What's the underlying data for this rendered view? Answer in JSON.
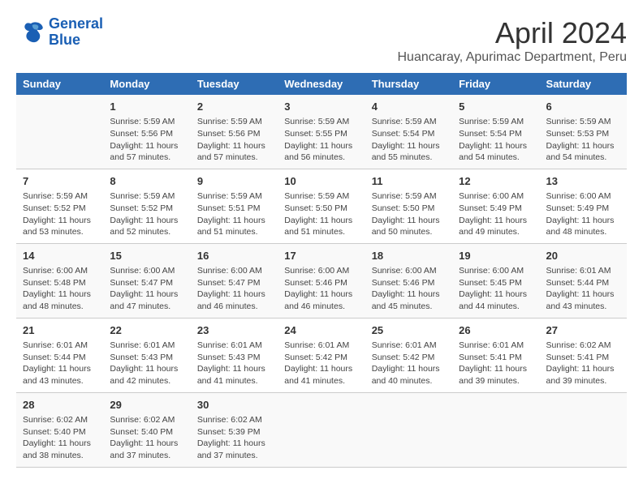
{
  "header": {
    "logo_line1": "General",
    "logo_line2": "Blue",
    "month": "April 2024",
    "location": "Huancaray, Apurimac Department, Peru"
  },
  "columns": [
    "Sunday",
    "Monday",
    "Tuesday",
    "Wednesday",
    "Thursday",
    "Friday",
    "Saturday"
  ],
  "weeks": [
    [
      {
        "day": "",
        "text": ""
      },
      {
        "day": "1",
        "text": "Sunrise: 5:59 AM\nSunset: 5:56 PM\nDaylight: 11 hours\nand 57 minutes."
      },
      {
        "day": "2",
        "text": "Sunrise: 5:59 AM\nSunset: 5:56 PM\nDaylight: 11 hours\nand 57 minutes."
      },
      {
        "day": "3",
        "text": "Sunrise: 5:59 AM\nSunset: 5:55 PM\nDaylight: 11 hours\nand 56 minutes."
      },
      {
        "day": "4",
        "text": "Sunrise: 5:59 AM\nSunset: 5:54 PM\nDaylight: 11 hours\nand 55 minutes."
      },
      {
        "day": "5",
        "text": "Sunrise: 5:59 AM\nSunset: 5:54 PM\nDaylight: 11 hours\nand 54 minutes."
      },
      {
        "day": "6",
        "text": "Sunrise: 5:59 AM\nSunset: 5:53 PM\nDaylight: 11 hours\nand 54 minutes."
      }
    ],
    [
      {
        "day": "7",
        "text": "Sunrise: 5:59 AM\nSunset: 5:52 PM\nDaylight: 11 hours\nand 53 minutes."
      },
      {
        "day": "8",
        "text": "Sunrise: 5:59 AM\nSunset: 5:52 PM\nDaylight: 11 hours\nand 52 minutes."
      },
      {
        "day": "9",
        "text": "Sunrise: 5:59 AM\nSunset: 5:51 PM\nDaylight: 11 hours\nand 51 minutes."
      },
      {
        "day": "10",
        "text": "Sunrise: 5:59 AM\nSunset: 5:50 PM\nDaylight: 11 hours\nand 51 minutes."
      },
      {
        "day": "11",
        "text": "Sunrise: 5:59 AM\nSunset: 5:50 PM\nDaylight: 11 hours\nand 50 minutes."
      },
      {
        "day": "12",
        "text": "Sunrise: 6:00 AM\nSunset: 5:49 PM\nDaylight: 11 hours\nand 49 minutes."
      },
      {
        "day": "13",
        "text": "Sunrise: 6:00 AM\nSunset: 5:49 PM\nDaylight: 11 hours\nand 48 minutes."
      }
    ],
    [
      {
        "day": "14",
        "text": "Sunrise: 6:00 AM\nSunset: 5:48 PM\nDaylight: 11 hours\nand 48 minutes."
      },
      {
        "day": "15",
        "text": "Sunrise: 6:00 AM\nSunset: 5:47 PM\nDaylight: 11 hours\nand 47 minutes."
      },
      {
        "day": "16",
        "text": "Sunrise: 6:00 AM\nSunset: 5:47 PM\nDaylight: 11 hours\nand 46 minutes."
      },
      {
        "day": "17",
        "text": "Sunrise: 6:00 AM\nSunset: 5:46 PM\nDaylight: 11 hours\nand 46 minutes."
      },
      {
        "day": "18",
        "text": "Sunrise: 6:00 AM\nSunset: 5:46 PM\nDaylight: 11 hours\nand 45 minutes."
      },
      {
        "day": "19",
        "text": "Sunrise: 6:00 AM\nSunset: 5:45 PM\nDaylight: 11 hours\nand 44 minutes."
      },
      {
        "day": "20",
        "text": "Sunrise: 6:01 AM\nSunset: 5:44 PM\nDaylight: 11 hours\nand 43 minutes."
      }
    ],
    [
      {
        "day": "21",
        "text": "Sunrise: 6:01 AM\nSunset: 5:44 PM\nDaylight: 11 hours\nand 43 minutes."
      },
      {
        "day": "22",
        "text": "Sunrise: 6:01 AM\nSunset: 5:43 PM\nDaylight: 11 hours\nand 42 minutes."
      },
      {
        "day": "23",
        "text": "Sunrise: 6:01 AM\nSunset: 5:43 PM\nDaylight: 11 hours\nand 41 minutes."
      },
      {
        "day": "24",
        "text": "Sunrise: 6:01 AM\nSunset: 5:42 PM\nDaylight: 11 hours\nand 41 minutes."
      },
      {
        "day": "25",
        "text": "Sunrise: 6:01 AM\nSunset: 5:42 PM\nDaylight: 11 hours\nand 40 minutes."
      },
      {
        "day": "26",
        "text": "Sunrise: 6:01 AM\nSunset: 5:41 PM\nDaylight: 11 hours\nand 39 minutes."
      },
      {
        "day": "27",
        "text": "Sunrise: 6:02 AM\nSunset: 5:41 PM\nDaylight: 11 hours\nand 39 minutes."
      }
    ],
    [
      {
        "day": "28",
        "text": "Sunrise: 6:02 AM\nSunset: 5:40 PM\nDaylight: 11 hours\nand 38 minutes."
      },
      {
        "day": "29",
        "text": "Sunrise: 6:02 AM\nSunset: 5:40 PM\nDaylight: 11 hours\nand 37 minutes."
      },
      {
        "day": "30",
        "text": "Sunrise: 6:02 AM\nSunset: 5:39 PM\nDaylight: 11 hours\nand 37 minutes."
      },
      {
        "day": "",
        "text": ""
      },
      {
        "day": "",
        "text": ""
      },
      {
        "day": "",
        "text": ""
      },
      {
        "day": "",
        "text": ""
      }
    ]
  ]
}
